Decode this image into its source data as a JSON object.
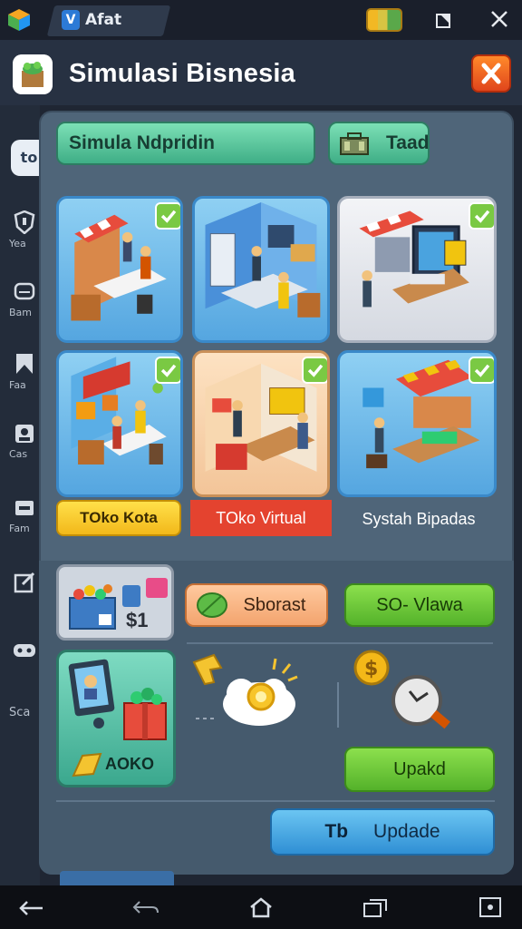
{
  "topbar": {
    "tab_label": "Afat",
    "tab_icon_letter": "V"
  },
  "header": {
    "title": "Simulasi Bisnesia"
  },
  "sidebar": {
    "top_badge": "to",
    "items": [
      {
        "label": "Yea",
        "icon": "shield-icon"
      },
      {
        "label": "Bam",
        "icon": "chat-icon"
      },
      {
        "label": "Faa",
        "icon": "bookmark-icon"
      },
      {
        "label": "Cas",
        "icon": "user-icon"
      },
      {
        "label": "Fam",
        "icon": "store-icon"
      },
      {
        "label": "",
        "icon": "edit-icon"
      },
      {
        "label": "",
        "icon": "gamepad-icon"
      },
      {
        "label": "Sca",
        "icon": ""
      }
    ]
  },
  "panel": {
    "sim_button": "Simula Ndpridin",
    "tool_button": "Taad"
  },
  "cards": [
    {
      "label": "",
      "checked": true
    },
    {
      "label": "",
      "checked": false
    },
    {
      "label": "",
      "checked": true
    },
    {
      "label": "TOko Kota",
      "checked": true
    },
    {
      "label": "TOko Virtual",
      "checked": true
    },
    {
      "label": "Systah Bipadas",
      "checked": true
    }
  ],
  "lower": {
    "crate_count": "$1",
    "shortcut_button": "Sborast",
    "so_button": "SO- Vlawa",
    "profile_label": "AOKO",
    "upakd_button": "Upakd",
    "update_prefix": "Tb",
    "update_button": "Updade"
  },
  "colors": {
    "panel": "#4f6579",
    "accent_green": "#54b22a",
    "accent_blue": "#2f8fd4",
    "close_orange": "#e0451c"
  }
}
